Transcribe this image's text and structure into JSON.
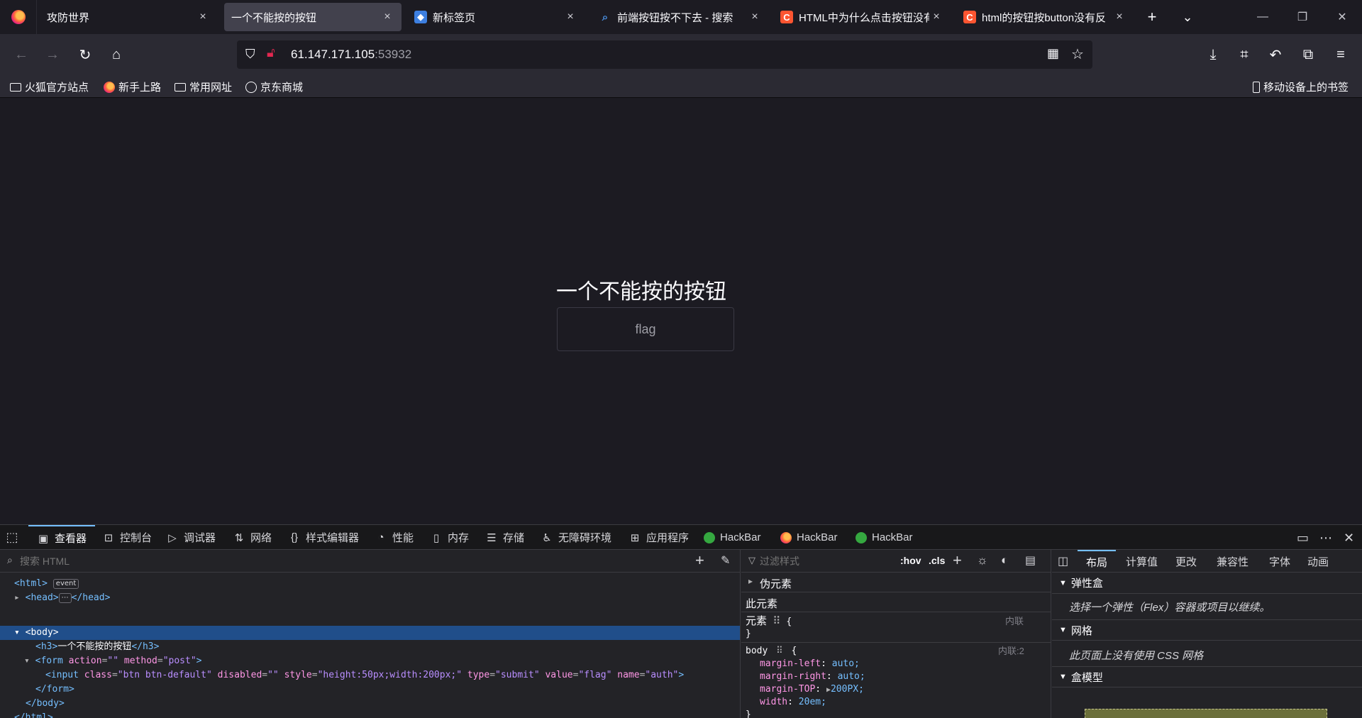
{
  "tabs": [
    {
      "title": "攻防世界",
      "close": "×"
    },
    {
      "title": "一个不能按的按钮",
      "close": "×"
    },
    {
      "title": "新标签页",
      "close": "×"
    },
    {
      "title": "前端按钮按不下去 - 搜索",
      "close": "×"
    },
    {
      "title": "HTML中为什么点击按钮没有",
      "close": "×"
    },
    {
      "title": "html的按钮按button没有反",
      "close": "×"
    }
  ],
  "urlbar": {
    "host": "61.147.171.105",
    "port": ":53932"
  },
  "bookmarks": [
    "火狐官方站点",
    "新手上路",
    "常用网址",
    "京东商城"
  ],
  "bookmarks_right": "移动设备上的书签",
  "page": {
    "heading": "一个不能按的按钮",
    "button_value": "flag"
  },
  "devtools": {
    "tabs": [
      "查看器",
      "控制台",
      "调试器",
      "网络",
      "样式编辑器",
      "性能",
      "内存",
      "存储",
      "无障碍环境",
      "应用程序",
      "HackBar",
      "HackBar",
      "HackBar"
    ],
    "search_placeholder": "搜索 HTML",
    "filter_placeholder": "过滤样式",
    "hov": ":hov",
    "cls": ".cls",
    "event_badge": "event",
    "ellipsis_badge": "⋯",
    "tree": {
      "html_open": "<html>",
      "head": "<head>",
      "head_close": "</head>",
      "body_open": "<body>",
      "h3_open": "<h3>",
      "h3_text": "一个不能按的按钮",
      "h3_close": "</h3>",
      "form_tag": "<form",
      "form_action_attr": "action",
      "form_action_val": "\"\"",
      "form_method_attr": "method",
      "form_method_val": "\"post\"",
      "form_end": ">",
      "input_tag": "<input",
      "input_class_attr": "class",
      "input_class_val": "\"btn btn-default\"",
      "input_disabled_attr": "disabled",
      "input_disabled_val": "\"\"",
      "input_style_attr": "style",
      "input_style_val": "\"height:50px;width:200px;\"",
      "input_type_attr": "type",
      "input_type_val": "\"submit\"",
      "input_value_attr": "value",
      "input_value_val": "\"flag\"",
      "input_name_attr": "name",
      "input_name_val": "\"auth\"",
      "input_end": ">",
      "form_close": "</form>",
      "body_close": "</body>",
      "html_close": "</html>"
    },
    "rules": {
      "pseudo": "伪元素",
      "this_element": "此元素",
      "element_label": "元素",
      "inline": "内联",
      "inline2": "内联:2",
      "body_selector": "body",
      "open_brace": "{",
      "close_brace": "}",
      "decls": [
        {
          "prop": "margin-left",
          "val": "auto;"
        },
        {
          "prop": "margin-right",
          "val": "auto;"
        },
        {
          "prop": "margin-TOP",
          "val": "200PX;"
        },
        {
          "prop": "width",
          "val": "20em;"
        }
      ]
    },
    "right_tabs": [
      "布局",
      "计算值",
      "更改",
      "兼容性",
      "字体",
      "动画"
    ],
    "sections": [
      {
        "title": "弹性盒",
        "body": "选择一个弹性（Flex）容器或项目以继续。"
      },
      {
        "title": "网格",
        "body": "此页面上没有使用 CSS 网格"
      },
      {
        "title": "盒模型",
        "body": ""
      }
    ]
  }
}
